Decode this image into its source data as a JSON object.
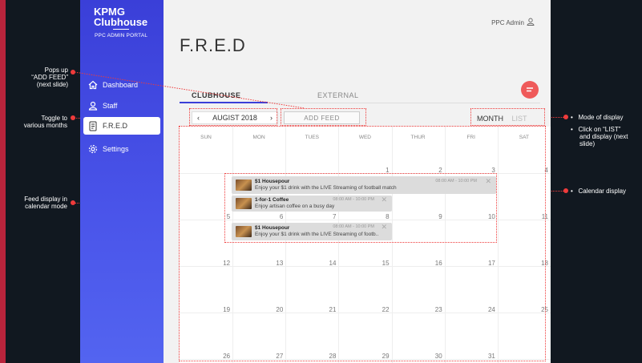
{
  "annotations": {
    "popup": [
      "Pops up",
      "“ADD FEED”",
      "(next slide)"
    ],
    "toggle": [
      "Toggle to",
      "various months"
    ],
    "feed": [
      "Feed display in",
      "calendar mode"
    ],
    "mode_title": "Mode of display",
    "mode_click": [
      "Click on “LIST”",
      "and display (next",
      "slide)"
    ],
    "calendar": "Calendar display"
  },
  "sidebar": {
    "brand_line1": "KPMG",
    "brand_line2": "Clubhouse",
    "brand_sub": "PPC ADMIN PORTAL",
    "items": [
      {
        "label": "Dashboard",
        "icon": "home-icon"
      },
      {
        "label": "Staff",
        "icon": "person-icon"
      },
      {
        "label": "F.R.E.D",
        "icon": "document-icon"
      },
      {
        "label": "Settings",
        "icon": "gear-icon"
      }
    ]
  },
  "header": {
    "user": "PPC Admin",
    "title": "F.R.E.D"
  },
  "tabs": {
    "active": "CLUBHOUSE",
    "inactive": "EXTERNAL"
  },
  "toolbar": {
    "month": "AUGIST 2018",
    "add_feed": "ADD FEED",
    "mode_month": "MONTH",
    "mode_list": "LIST"
  },
  "calendar": {
    "days": [
      "SUN",
      "MON",
      "TUES",
      "WED",
      "THUR",
      "FRI",
      "SAT"
    ],
    "weeks": [
      [
        "",
        "",
        "",
        "1",
        "2",
        "3",
        "4"
      ],
      [
        "5",
        "6",
        "7",
        "8",
        "9",
        "10",
        "11"
      ],
      [
        "12",
        "13",
        "14",
        "15",
        "16",
        "17",
        "18"
      ],
      [
        "19",
        "20",
        "21",
        "22",
        "23",
        "24",
        "25"
      ],
      [
        "26",
        "27",
        "28",
        "29",
        "30",
        "31",
        ""
      ]
    ]
  },
  "feeds": [
    {
      "title": "$1 Housepour",
      "desc": "Enjoy your $1 drink with the LIVE Streaming of football match",
      "time": "08:00 AM - 10:00 PM"
    },
    {
      "title": "1-for-1 Coffee",
      "desc": "Enjoy artisan coffee on a busy day",
      "time": "08:00 AM - 10:00 PM"
    },
    {
      "title": "$1 Housepour",
      "desc": "Enjoy your $1 drink with the LIVE Streaming of footb..",
      "time": "08:00 AM - 10:00 PM"
    }
  ],
  "colors": {
    "accent": "#3a3fd8",
    "annotation": "#ef3b3b",
    "chat": "#ef5a5a"
  }
}
